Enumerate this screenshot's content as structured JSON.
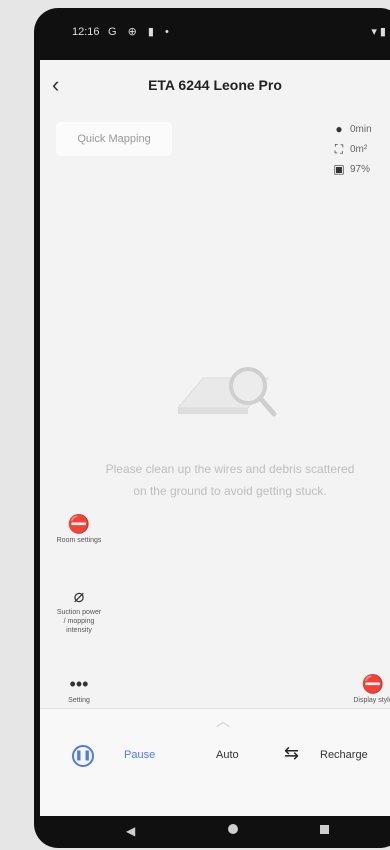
{
  "status": {
    "time": "12:16",
    "icons_left": "G ⊕ ▮ •",
    "icons_right": "▾ ▮"
  },
  "header": {
    "title": "ETA 6244 Leone Pro",
    "back_icon": "chevron-left-icon"
  },
  "quick_mapping": {
    "label": "Quick Mapping"
  },
  "stats": {
    "time": {
      "value": "0min",
      "icon": "clock-icon"
    },
    "area": {
      "value": "0m²",
      "icon": "area-icon"
    },
    "battery": {
      "value": "97%",
      "icon": "battery-icon"
    }
  },
  "message": {
    "text": "Please clean up the wires and debris scattered on the ground to avoid getting stuck."
  },
  "side_buttons": [
    {
      "label": "Room settings",
      "icon": "room-settings-icon"
    },
    {
      "label": "Suction power / mopping intensity",
      "icon": "leaf-icon"
    },
    {
      "label": "Setting",
      "icon": "more-icon"
    }
  ],
  "right_button": {
    "label": "Display style",
    "icon": "display-style-icon"
  },
  "controls": {
    "pause_label": "Pause",
    "auto_label": "Auto",
    "recharge_label": "Recharge"
  },
  "colors": {
    "accent": "#4f7be8"
  }
}
